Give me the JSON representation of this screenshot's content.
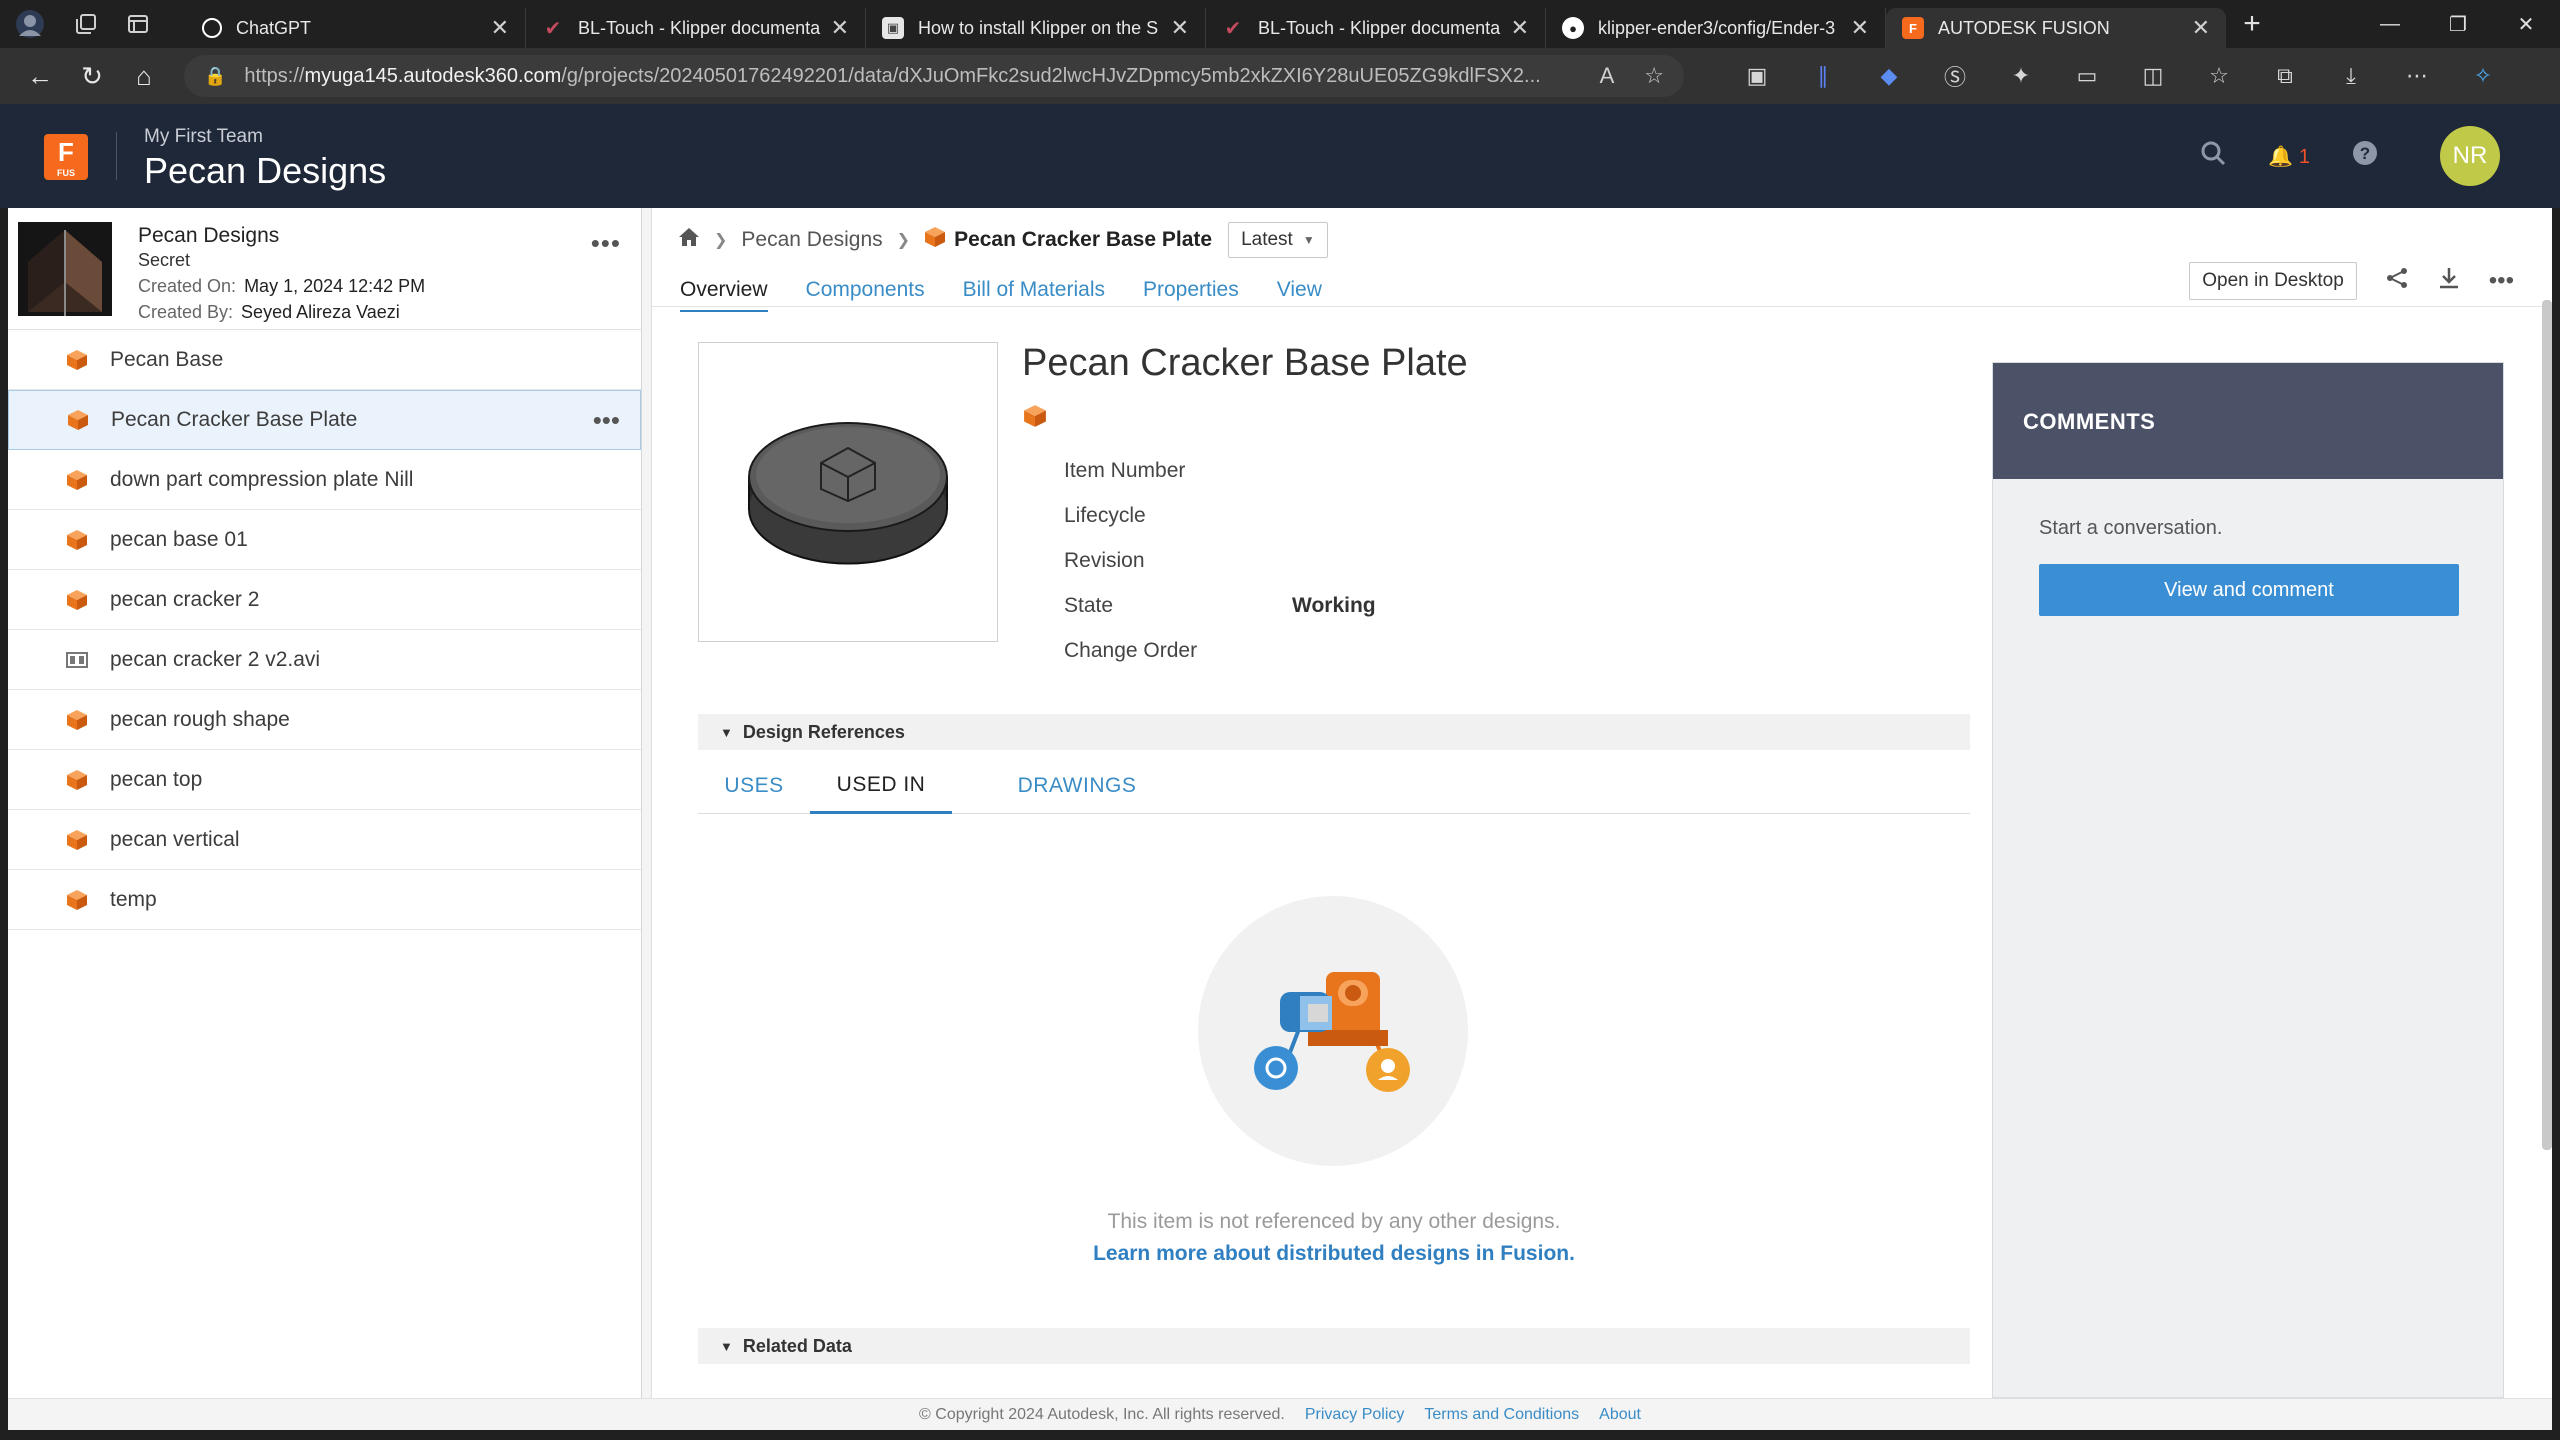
{
  "browser": {
    "tabs": [
      {
        "title": "ChatGPT",
        "favicon": "chatgpt-icon",
        "color": "#ffffff"
      },
      {
        "title": "BL-Touch - Klipper documenta",
        "favicon": "klipper-icon",
        "color": "#b5384c"
      },
      {
        "title": "How to install Klipper on the S",
        "favicon": "page-icon",
        "color": "#e0e0e0"
      },
      {
        "title": "BL-Touch - Klipper documenta",
        "favicon": "klipper-icon",
        "color": "#b5384c"
      },
      {
        "title": "klipper-ender3/config/Ender-3",
        "favicon": "github-icon",
        "color": "#ffffff"
      },
      {
        "title": "AUTODESK FUSION",
        "favicon": "fusion-icon",
        "color": "#f56a1d"
      }
    ],
    "url_prefix": "https://",
    "url_host": "myuga145.autodesk360.com",
    "url_path": "/g/projects/20240501762492201/data/dXJuOmFkc2sud2lwcHJvZDpmcy5mb2xkZXI6Y28uUE05ZG9kdlFSX2..."
  },
  "header": {
    "logo_letter": "F",
    "logo_sub": "FUS",
    "team": "My First Team",
    "project": "Pecan Designs",
    "notification_count": "1",
    "avatar_initials": "NR"
  },
  "project_card": {
    "name": "Pecan Designs",
    "security": "Secret",
    "created_on_label": "Created On:",
    "created_on": "May 1, 2024 12:42 PM",
    "created_by_label": "Created By:",
    "created_by": "Seyed Alireza Vaezi"
  },
  "files": [
    {
      "name": "Pecan Base",
      "icon": "design-cube-icon"
    },
    {
      "name": "Pecan Cracker Base Plate",
      "icon": "design-cube-icon"
    },
    {
      "name": "down part compression plate Nill",
      "icon": "design-cube-icon"
    },
    {
      "name": "pecan base 01",
      "icon": "design-cube-icon"
    },
    {
      "name": "pecan cracker 2",
      "icon": "design-cube-icon"
    },
    {
      "name": "pecan cracker 2 v2.avi",
      "icon": "video-file-icon"
    },
    {
      "name": "pecan rough shape",
      "icon": "design-cube-icon"
    },
    {
      "name": "pecan top",
      "icon": "design-cube-icon"
    },
    {
      "name": "pecan vertical",
      "icon": "design-cube-icon"
    },
    {
      "name": "temp",
      "icon": "design-cube-icon"
    }
  ],
  "breadcrumb": {
    "parent": "Pecan Designs",
    "current": "Pecan Cracker Base Plate",
    "version": "Latest"
  },
  "tabs": [
    "Overview",
    "Components",
    "Bill of Materials",
    "Properties",
    "View"
  ],
  "open_in_desktop": "Open in Desktop",
  "item": {
    "title": "Pecan Cracker Base Plate",
    "properties": [
      {
        "label": "Item Number",
        "value": ""
      },
      {
        "label": "Lifecycle",
        "value": ""
      },
      {
        "label": "Revision",
        "value": ""
      },
      {
        "label": "State",
        "value": "Working"
      },
      {
        "label": "Change Order",
        "value": ""
      }
    ]
  },
  "design_references": {
    "heading": "Design References",
    "tabs": [
      "USES",
      "USED IN",
      "DRAWINGS"
    ],
    "empty_message": "This item is not referenced by any other designs.",
    "learn_more": "Learn more about distributed designs in Fusion."
  },
  "related_data": {
    "heading": "Related Data"
  },
  "comments": {
    "heading": "COMMENTS",
    "prompt": "Start a conversation.",
    "button": "View and comment"
  },
  "footer": {
    "copyright": "© Copyright 2024 Autodesk, Inc. All rights reserved.",
    "links": [
      "Privacy Policy",
      "Terms and Conditions",
      "About"
    ]
  },
  "colors": {
    "accent": "#2f7fc1",
    "header_bg": "#1f2839",
    "fusion_orange": "#f56a1d",
    "avatar": "#c1c949"
  }
}
